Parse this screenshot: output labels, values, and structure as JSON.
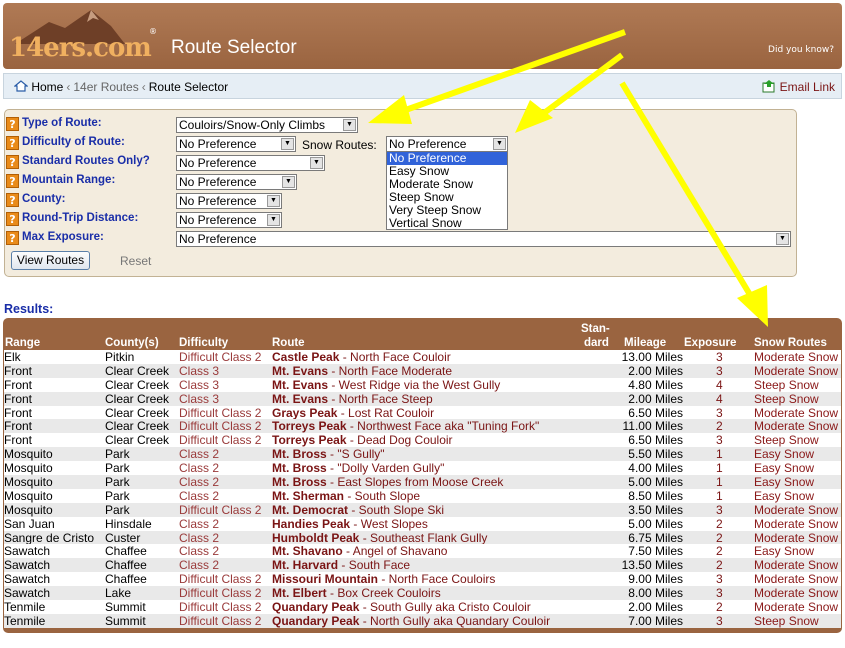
{
  "header": {
    "logo_text": "14ers.com",
    "logo_reg": "®",
    "title": "Route Selector",
    "did_you_know": "Did you know?"
  },
  "breadcrumb": {
    "home": "Home",
    "sep": "‹",
    "routes": "14er Routes",
    "current": "Route Selector",
    "email_link": "Email Link"
  },
  "filters": {
    "type_of_route": {
      "label": "Type of Route:",
      "value": "Couloirs/Snow-Only Climbs"
    },
    "difficulty": {
      "label": "Difficulty of Route:",
      "value": "No Preference"
    },
    "snow_routes": {
      "label": "Snow Routes:",
      "value": "No Preference",
      "options": [
        "No Preference",
        "Easy Snow",
        "Moderate Snow",
        "Steep Snow",
        "Very Steep Snow",
        "Vertical Snow"
      ]
    },
    "standard_only": {
      "label": "Standard Routes Only?",
      "value": "No Preference"
    },
    "mountain_range": {
      "label": "Mountain Range:",
      "value": "No Preference"
    },
    "county": {
      "label": "County:",
      "value": "No Preference"
    },
    "round_trip": {
      "label": "Round-Trip Distance:",
      "value": "No Preference"
    },
    "max_exposure": {
      "label": "Max Exposure:",
      "value": "No Preference"
    },
    "help_glyph": "?",
    "view_button": "View Routes",
    "reset": "Reset"
  },
  "results": {
    "label": "Results:",
    "columns": {
      "range": "Range",
      "county": "County(s)",
      "difficulty": "Difficulty",
      "route": "Route",
      "standard_1": "Stan-",
      "standard_2": "dard",
      "mileage": "Mileage",
      "exposure": "Exposure",
      "snow": "Snow Routes"
    },
    "rows": [
      {
        "range": "Elk",
        "county": "Pitkin",
        "difficulty": "Difficult Class 2",
        "peak": "Castle Peak",
        "route": " - North Face Couloir",
        "mileage": "13.00 Miles",
        "exposure": "3",
        "snow": "Moderate Snow"
      },
      {
        "range": "Front",
        "county": "Clear Creek",
        "difficulty": "Class 3",
        "peak": "Mt. Evans",
        "route": " - North Face Moderate",
        "mileage": "2.00 Miles",
        "exposure": "3",
        "snow": "Moderate Snow"
      },
      {
        "range": "Front",
        "county": "Clear Creek",
        "difficulty": "Class 3",
        "peak": "Mt. Evans",
        "route": " - West Ridge via the West Gully",
        "mileage": "4.80 Miles",
        "exposure": "4",
        "snow": "Steep Snow"
      },
      {
        "range": "Front",
        "county": "Clear Creek",
        "difficulty": "Class 3",
        "peak": "Mt. Evans",
        "route": " - North Face Steep",
        "mileage": "2.00 Miles",
        "exposure": "4",
        "snow": "Steep Snow"
      },
      {
        "range": "Front",
        "county": "Clear Creek",
        "difficulty": "Difficult Class 2",
        "peak": "Grays Peak",
        "route": " - Lost Rat Couloir",
        "mileage": "6.50 Miles",
        "exposure": "3",
        "snow": "Moderate Snow"
      },
      {
        "range": "Front",
        "county": "Clear Creek",
        "difficulty": "Difficult Class 2",
        "peak": "Torreys Peak",
        "route": " - Northwest Face aka \"Tuning Fork\"",
        "mileage": "11.00 Miles",
        "exposure": "2",
        "snow": "Moderate Snow"
      },
      {
        "range": "Front",
        "county": "Clear Creek",
        "difficulty": "Difficult Class 2",
        "peak": "Torreys Peak",
        "route": " - Dead Dog Couloir",
        "mileage": "6.50 Miles",
        "exposure": "3",
        "snow": "Steep Snow"
      },
      {
        "range": "Mosquito",
        "county": "Park",
        "difficulty": "Class 2",
        "peak": "Mt. Bross",
        "route": " - \"S Gully\"",
        "mileage": "5.50 Miles",
        "exposure": "1",
        "snow": "Easy Snow"
      },
      {
        "range": "Mosquito",
        "county": "Park",
        "difficulty": "Class 2",
        "peak": "Mt. Bross",
        "route": " - \"Dolly Varden Gully\"",
        "mileage": "4.00 Miles",
        "exposure": "1",
        "snow": "Easy Snow"
      },
      {
        "range": "Mosquito",
        "county": "Park",
        "difficulty": "Class 2",
        "peak": "Mt. Bross",
        "route": " - East Slopes from Moose Creek",
        "mileage": "5.00 Miles",
        "exposure": "1",
        "snow": "Easy Snow"
      },
      {
        "range": "Mosquito",
        "county": "Park",
        "difficulty": "Class 2",
        "peak": "Mt. Sherman",
        "route": " - South Slope",
        "mileage": "8.50 Miles",
        "exposure": "1",
        "snow": "Easy Snow"
      },
      {
        "range": "Mosquito",
        "county": "Park",
        "difficulty": "Difficult Class 2",
        "peak": "Mt. Democrat",
        "route": " - South Slope Ski",
        "mileage": "3.50 Miles",
        "exposure": "3",
        "snow": "Moderate Snow"
      },
      {
        "range": "San Juan",
        "county": "Hinsdale",
        "difficulty": "Class 2",
        "peak": "Handies Peak",
        "route": " - West Slopes",
        "mileage": "5.00 Miles",
        "exposure": "2",
        "snow": "Moderate Snow"
      },
      {
        "range": "Sangre de Cristo",
        "county": "Custer",
        "difficulty": "Class 2",
        "peak": "Humboldt Peak",
        "route": " - Southeast Flank Gully",
        "mileage": "6.75 Miles",
        "exposure": "2",
        "snow": "Moderate Snow"
      },
      {
        "range": "Sawatch",
        "county": "Chaffee",
        "difficulty": "Class 2",
        "peak": "Mt. Shavano",
        "route": " - Angel of Shavano",
        "mileage": "7.50 Miles",
        "exposure": "2",
        "snow": "Easy Snow"
      },
      {
        "range": "Sawatch",
        "county": "Chaffee",
        "difficulty": "Class 2",
        "peak": "Mt. Harvard",
        "route": " - South Face",
        "mileage": "13.50 Miles",
        "exposure": "2",
        "snow": "Moderate Snow"
      },
      {
        "range": "Sawatch",
        "county": "Chaffee",
        "difficulty": "Difficult Class 2",
        "peak": "Missouri Mountain",
        "route": " - North Face Couloirs",
        "mileage": "9.00 Miles",
        "exposure": "3",
        "snow": "Moderate Snow"
      },
      {
        "range": "Sawatch",
        "county": "Lake",
        "difficulty": "Difficult Class 2",
        "peak": "Mt. Elbert",
        "route": " - Box Creek Couloirs",
        "mileage": "8.00 Miles",
        "exposure": "3",
        "snow": "Moderate Snow"
      },
      {
        "range": "Tenmile",
        "county": "Summit",
        "difficulty": "Difficult Class 2",
        "peak": "Quandary Peak",
        "route": " - South Gully aka Cristo Couloir",
        "mileage": "2.00 Miles",
        "exposure": "2",
        "snow": "Moderate Snow"
      },
      {
        "range": "Tenmile",
        "county": "Summit",
        "difficulty": "Difficult Class 2",
        "peak": "Quandary Peak",
        "route": " - North Gully aka Quandary Couloir",
        "mileage": "7.00 Miles",
        "exposure": "3",
        "snow": "Steep Snow"
      }
    ]
  },
  "colors": {
    "header_brown": "#9a6440",
    "label_blue": "#1a2ea8",
    "link_red": "#7a1414",
    "annotation_yellow": "#ffff00"
  },
  "icons": {
    "home": "home-icon",
    "email": "email-icon",
    "help": "help-icon",
    "dropdown": "chevron-down-icon"
  }
}
